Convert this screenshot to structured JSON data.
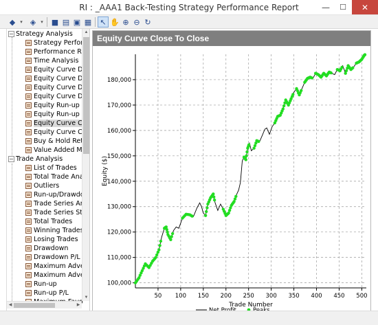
{
  "window": {
    "title": "RI : _AAA1 Back-Testing Strategy Performance Report",
    "minimize_glyph": "—",
    "maximize_glyph": "☐",
    "close_glyph": "✕"
  },
  "toolbar": {
    "buttons": [
      {
        "name": "nav-back-icon",
        "glyph": "◆"
      },
      {
        "name": "nav-forward-icon",
        "glyph": "◈"
      },
      {
        "name": "save-icon",
        "glyph": "■"
      },
      {
        "name": "print-preview-icon",
        "glyph": "▤"
      },
      {
        "name": "print-icon",
        "glyph": "▣"
      },
      {
        "name": "export-icon",
        "glyph": "▦"
      },
      {
        "name": "pointer-icon",
        "glyph": "↖"
      },
      {
        "name": "pan-hand-icon",
        "glyph": "✋"
      },
      {
        "name": "zoom-in-icon",
        "glyph": "⊕"
      },
      {
        "name": "zoom-out-icon",
        "glyph": "⊖"
      },
      {
        "name": "refresh-icon",
        "glyph": "↻"
      }
    ],
    "dropdown_glyph": "▾"
  },
  "tree": {
    "expander_open": "−",
    "groups": [
      {
        "label": "Strategy Analysis",
        "items": [
          "Strategy Perform",
          "Performance Rati",
          "Time Analysis",
          "Equity Curve Deta",
          "Equity Curve Deta",
          "Equity Curve Deta",
          "Equity Curve Deta",
          "Equity Run-up &",
          "Equity Run-up &",
          "Equity Curve Clos",
          "Equity Curve Clos",
          "Buy & Hold Retu",
          "Value Added Mo"
        ],
        "selected_index": 9
      },
      {
        "label": "Trade Analysis",
        "items": [
          "List of Trades",
          "Total Trade Analy",
          "Outliers",
          "Run-up/Drawdov",
          "Trade Series Anal",
          "Trade Series Stati",
          "Total Trades",
          "Winning Trades",
          "Losing Trades",
          "Drawdown",
          "Drawdown P/L",
          "Maximum Adver",
          "Maximum Adver",
          "Run-up",
          "Run-up P/L",
          "Maximum Favo"
        ]
      }
    ],
    "scroll_up": "▲",
    "scroll_down": "▼",
    "scroll_left": "◀",
    "scroll_right": "▶"
  },
  "pane": {
    "title": "Equity Curve Close To Close"
  },
  "chart_data": {
    "type": "line",
    "xlabel": "Trade Number",
    "ylabel": "Equity ($)",
    "xlim": [
      0,
      510
    ],
    "ylim": [
      98000,
      190000
    ],
    "xticks": [
      50,
      100,
      150,
      200,
      250,
      300,
      350,
      400,
      450,
      500
    ],
    "yticks": [
      100000,
      110000,
      120000,
      130000,
      140000,
      150000,
      160000,
      170000,
      180000
    ],
    "ytick_labels": [
      "100,000",
      "110,000",
      "120,000",
      "130,000",
      "140,000",
      "150,000",
      "160,000",
      "170,000",
      "180,000"
    ],
    "grid": true,
    "legend_placement": "bottom-center",
    "series": [
      {
        "name": "Net Profit",
        "color": "#000000",
        "points": [
          [
            0,
            100000
          ],
          [
            8,
            102000
          ],
          [
            15,
            104800
          ],
          [
            22,
            107500
          ],
          [
            30,
            106000
          ],
          [
            38,
            108500
          ],
          [
            45,
            110000
          ],
          [
            52,
            113000
          ],
          [
            58,
            118000
          ],
          [
            64,
            121500
          ],
          [
            68,
            122000
          ],
          [
            72,
            119000
          ],
          [
            78,
            117000
          ],
          [
            84,
            120500
          ],
          [
            90,
            122000
          ],
          [
            96,
            121500
          ],
          [
            104,
            125500
          ],
          [
            112,
            127000
          ],
          [
            120,
            126800
          ],
          [
            128,
            126000
          ],
          [
            136,
            129500
          ],
          [
            142,
            131500
          ],
          [
            146,
            130000
          ],
          [
            150,
            127500
          ],
          [
            155,
            126500
          ],
          [
            160,
            131000
          ],
          [
            166,
            133500
          ],
          [
            172,
            135000
          ],
          [
            176,
            131500
          ],
          [
            182,
            128500
          ],
          [
            188,
            131000
          ],
          [
            194,
            129000
          ],
          [
            200,
            126500
          ],
          [
            206,
            127500
          ],
          [
            212,
            130500
          ],
          [
            218,
            132000
          ],
          [
            224,
            135000
          ],
          [
            228,
            136500
          ],
          [
            232,
            139500
          ],
          [
            236,
            148000
          ],
          [
            240,
            149500
          ],
          [
            244,
            148500
          ],
          [
            248,
            153000
          ],
          [
            252,
            155000
          ],
          [
            256,
            152000
          ],
          [
            262,
            153000
          ],
          [
            268,
            156000
          ],
          [
            274,
            155500
          ],
          [
            280,
            158000
          ],
          [
            286,
            160500
          ],
          [
            290,
            161000
          ],
          [
            296,
            158500
          ],
          [
            302,
            161500
          ],
          [
            308,
            163000
          ],
          [
            314,
            165500
          ],
          [
            320,
            166000
          ],
          [
            326,
            168500
          ],
          [
            332,
            172000
          ],
          [
            338,
            170000
          ],
          [
            344,
            172500
          ],
          [
            350,
            175000
          ],
          [
            356,
            176500
          ],
          [
            362,
            174000
          ],
          [
            368,
            176500
          ],
          [
            374,
            179000
          ],
          [
            380,
            180500
          ],
          [
            386,
            181000
          ],
          [
            392,
            180500
          ],
          [
            398,
            182500
          ],
          [
            404,
            182000
          ],
          [
            410,
            181000
          ],
          [
            416,
            182500
          ],
          [
            422,
            181500
          ],
          [
            428,
            183000
          ],
          [
            434,
            182500
          ],
          [
            440,
            182000
          ],
          [
            446,
            184000
          ],
          [
            452,
            183500
          ],
          [
            458,
            185500
          ],
          [
            464,
            182500
          ],
          [
            470,
            185500
          ],
          [
            476,
            184000
          ],
          [
            482,
            185000
          ],
          [
            488,
            186500
          ],
          [
            494,
            187000
          ],
          [
            500,
            188000
          ],
          [
            505,
            189500
          ],
          [
            508,
            190000
          ]
        ]
      },
      {
        "name": "Peaks",
        "color": "#22dd22"
      }
    ],
    "peak_segments": [
      [
        1,
        8
      ],
      [
        10,
        13
      ],
      [
        17,
        19
      ],
      [
        25,
        28
      ],
      [
        32,
        36
      ],
      [
        41,
        43
      ],
      [
        46,
        47
      ],
      [
        54,
        60
      ],
      [
        62,
        63
      ],
      [
        65,
        67
      ],
      [
        69,
        74
      ],
      [
        77,
        78
      ],
      [
        80,
        82
      ],
      [
        84,
        88
      ],
      [
        90,
        92
      ]
    ]
  }
}
